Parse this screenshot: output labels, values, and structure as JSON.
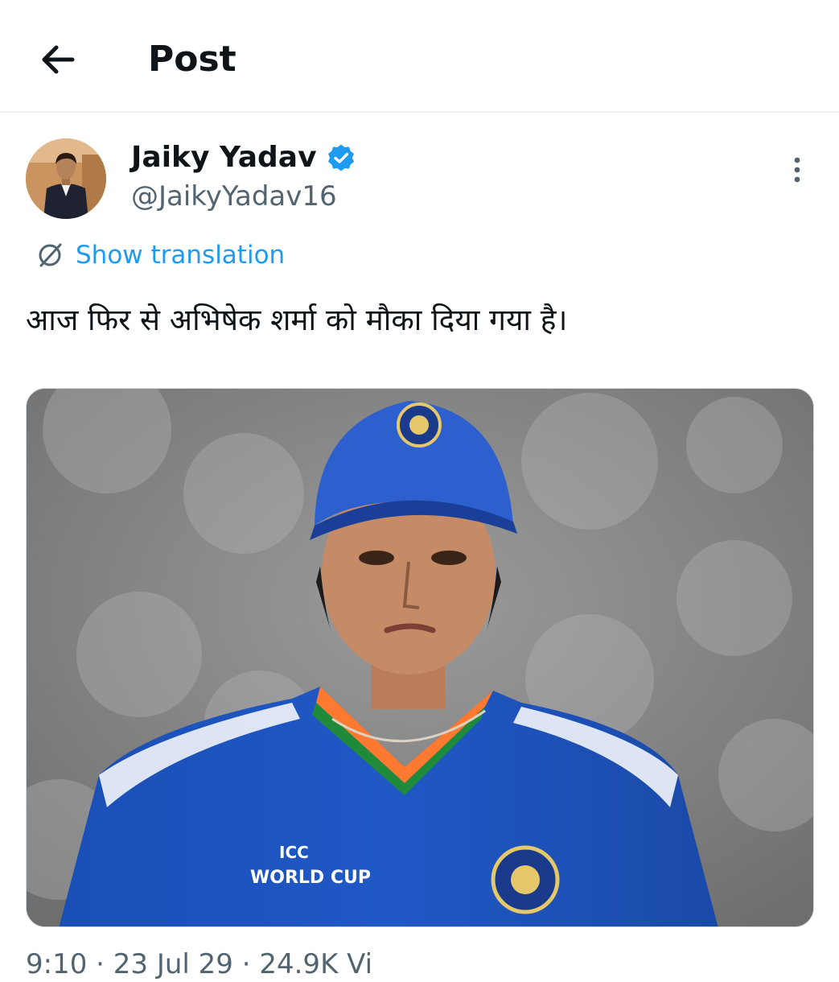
{
  "header": {
    "title": "Post",
    "back_icon": "arrow-left-icon"
  },
  "author": {
    "name": "Jaiky Yadav",
    "handle": "@JaikyYadav16",
    "verified": true,
    "verified_color": "#1d9bf0"
  },
  "translation": {
    "label": "Show translation",
    "icon": "translate-icon",
    "link_color": "#1d9bf0"
  },
  "post": {
    "text": "आज फिर से अभिषेक शर्मा को मौका दिया गया है।"
  },
  "media": {
    "type": "photo",
    "jersey_lines": [
      "ICC",
      "WORLD CUP"
    ]
  },
  "meta": {
    "partial_text": "9:10 · 23 Jul 29 · 24.9K Vi"
  },
  "colors": {
    "text": "#0f1419",
    "secondary": "#536471",
    "divider": "#eff3f4",
    "accent": "#1d9bf0"
  }
}
